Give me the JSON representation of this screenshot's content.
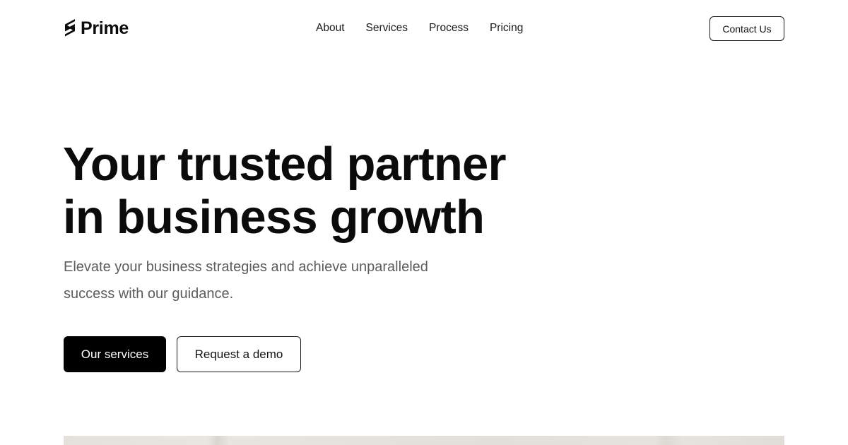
{
  "brand": {
    "name": "Prime",
    "icon": "bolt-logo-icon"
  },
  "nav": {
    "items": [
      {
        "label": "About"
      },
      {
        "label": "Services"
      },
      {
        "label": "Process"
      },
      {
        "label": "Pricing"
      }
    ]
  },
  "header": {
    "contact_label": "Contact Us"
  },
  "hero": {
    "headline_line1": "Your trusted partner",
    "headline_line2": "in business growth",
    "subtext_line1": "Elevate your business strategies and achieve unparalleled",
    "subtext_line2": "success with our guidance.",
    "primary_cta": "Our services",
    "secondary_cta": "Request a demo"
  },
  "colors": {
    "text": "#0b0b0b",
    "muted_text": "#5c5c5c",
    "primary_button_bg": "#000000",
    "background": "#ffffff"
  }
}
